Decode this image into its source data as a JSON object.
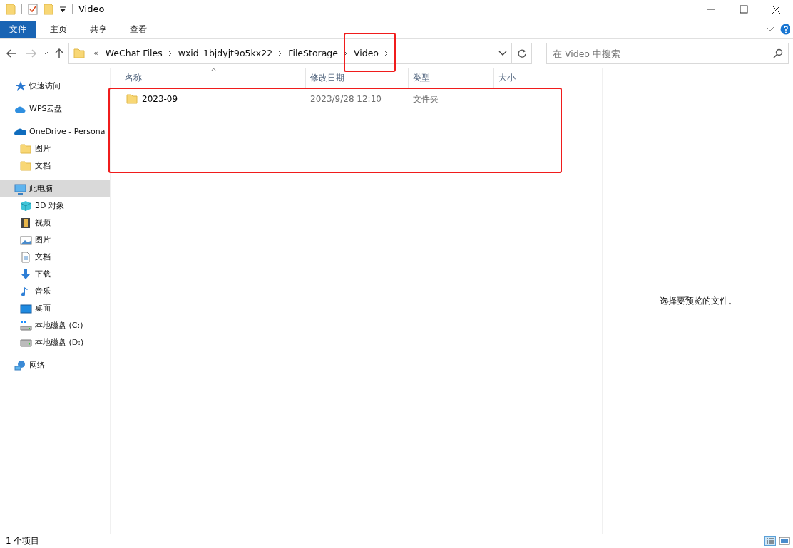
{
  "window": {
    "title": "Video"
  },
  "ribbon": {
    "tabs": [
      {
        "label": "文件",
        "selected": true
      },
      {
        "label": "主页",
        "selected": false
      },
      {
        "label": "共享",
        "selected": false
      },
      {
        "label": "查看",
        "selected": false
      }
    ]
  },
  "address_bar": {
    "overflow": "«",
    "crumbs": [
      {
        "label": "WeChat Files"
      },
      {
        "label": "wxid_1bjdyjt9o5kx22"
      },
      {
        "label": "FileStorage"
      },
      {
        "label": "Video",
        "highlighted": true
      }
    ]
  },
  "search": {
    "placeholder": "在 Video 中搜索"
  },
  "sidebar": {
    "groups": [
      {
        "items": [
          {
            "label": "快速访问",
            "kind": "star",
            "selected": false
          }
        ]
      },
      {
        "items": [
          {
            "label": "WPS云盘",
            "kind": "cloud",
            "selected": false
          }
        ]
      },
      {
        "items": [
          {
            "label": "OneDrive - Persona",
            "kind": "onedrive",
            "selected": false,
            "children": [
              {
                "label": "图片",
                "kind": "folder",
                "selected": false
              },
              {
                "label": "文档",
                "kind": "folder",
                "selected": false
              }
            ]
          }
        ]
      },
      {
        "items": [
          {
            "label": "此电脑",
            "kind": "pc",
            "selected": true,
            "children": [
              {
                "label": "3D 对象",
                "kind": "cube",
                "selected": false
              },
              {
                "label": "视频",
                "kind": "film",
                "selected": false
              },
              {
                "label": "图片",
                "kind": "image",
                "selected": false
              },
              {
                "label": "文档",
                "kind": "doc",
                "selected": false
              },
              {
                "label": "下载",
                "kind": "download",
                "selected": false
              },
              {
                "label": "音乐",
                "kind": "music",
                "selected": false
              },
              {
                "label": "桌面",
                "kind": "desktop",
                "selected": false
              },
              {
                "label": "本地磁盘 (C:)",
                "kind": "sysdrive",
                "selected": false
              },
              {
                "label": "本地磁盘 (D:)",
                "kind": "drive",
                "selected": false
              }
            ]
          }
        ]
      },
      {
        "items": [
          {
            "label": "网络",
            "kind": "network",
            "selected": false
          }
        ]
      }
    ]
  },
  "table": {
    "columns": [
      "名称",
      "修改日期",
      "类型",
      "大小"
    ],
    "rows": [
      {
        "name": "2023-09",
        "modified": "2023/9/28 12:10",
        "type": "文件夹"
      }
    ],
    "highlighted": true
  },
  "preview": {
    "message": "选择要预览的文件。"
  },
  "status_bar": {
    "text": "1 个项目"
  }
}
